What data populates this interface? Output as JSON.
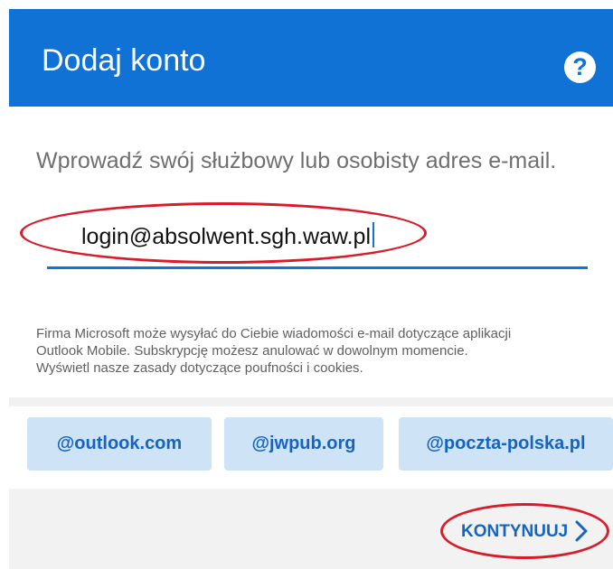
{
  "header": {
    "title": "Dodaj konto",
    "help_icon": "?"
  },
  "main": {
    "prompt": "Wprowadź swój służbowy lub osobisty adres e-mail.",
    "email_value": "login@absolwent.sgh.waw.pl",
    "disclaimer_lines": [
      "Firma Microsoft może wysyłać do Ciebie wiadomości e-mail dotyczące aplikacji",
      "Outlook Mobile. Subskrypcję możesz anulować w dowolnym momencie.",
      "Wyświetl nasze zasady dotyczące poufności i cookies."
    ]
  },
  "domains": [
    "@outlook.com",
    "@jwpub.org",
    "@poczta-polska.pl"
  ],
  "footer": {
    "continue_label": "KONTYNUUJ"
  },
  "colors": {
    "header_bg": "#0f72d4",
    "accent": "#1565c0",
    "chip_bg": "#cfe3f6",
    "annotation": "#d81c2a"
  },
  "icons": {
    "help": "help-icon",
    "continue": "chevron-right-icon"
  }
}
